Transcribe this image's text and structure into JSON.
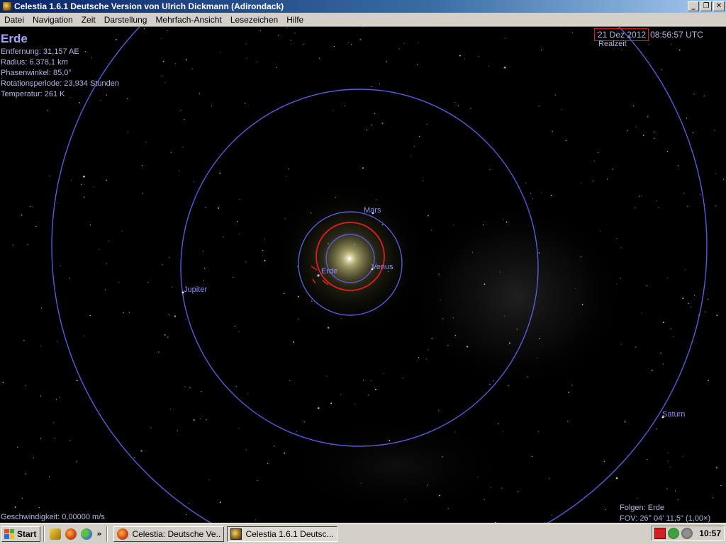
{
  "window": {
    "title": "Celestia 1.6.1 Deutsche Version von Ulrich Dickmann (Adirondack)",
    "icon": "celestia-app-icon",
    "controls": {
      "minimize": "_",
      "maximize": "❐",
      "close": "✕"
    }
  },
  "menu": {
    "items": [
      "Datei",
      "Navigation",
      "Zeit",
      "Darstellung",
      "Mehrfach-Ansicht",
      "Lesezeichen",
      "Hilfe"
    ]
  },
  "hud": {
    "object_name": "Erde",
    "info": [
      "Entfernung: 31,157 AE",
      "Radius: 6.378,1 km",
      "Phasenwinkel: 85,0°",
      "Rotationsperiode: 23,934 Stunden",
      "Temperatur: 261 K"
    ],
    "date": "21 Dez 2012",
    "time": "08:56:57 UTC",
    "time_mode": "Realzeit",
    "speed": "Geschwindigkeit: 0,00000 m/s",
    "follow": "Folgen: Erde",
    "fov": "FOV: 26° 04' 11,5\" (1,00×)"
  },
  "planets": [
    {
      "name": "Mars"
    },
    {
      "name": "Erde"
    },
    {
      "name": "Venus"
    },
    {
      "name": "Jupiter"
    },
    {
      "name": "Saturn"
    }
  ],
  "colors": {
    "orbit": "#5a5adc",
    "selected_orbit": "#e01e1e",
    "label": "#8c8cff",
    "hud_text": "#b4b4e6",
    "titlebar_start": "#0a246a",
    "titlebar_end": "#a6caf0"
  },
  "taskbar": {
    "start_label": "Start",
    "quicklaunch_icons": [
      "edit-icon",
      "firefox-icon",
      "messenger-icon"
    ],
    "chevron": "»",
    "tasks": [
      {
        "label": "Celestia: Deutsche Ve...",
        "icon": "firefox-icon",
        "active": false
      },
      {
        "label": "Celestia 1.6.1 Deutsc...",
        "icon": "celestia-app-icon",
        "active": true
      }
    ],
    "tray_icons": [
      "antivirus-icon",
      "torrent-icon",
      "network-icon"
    ],
    "clock": "10:57"
  }
}
